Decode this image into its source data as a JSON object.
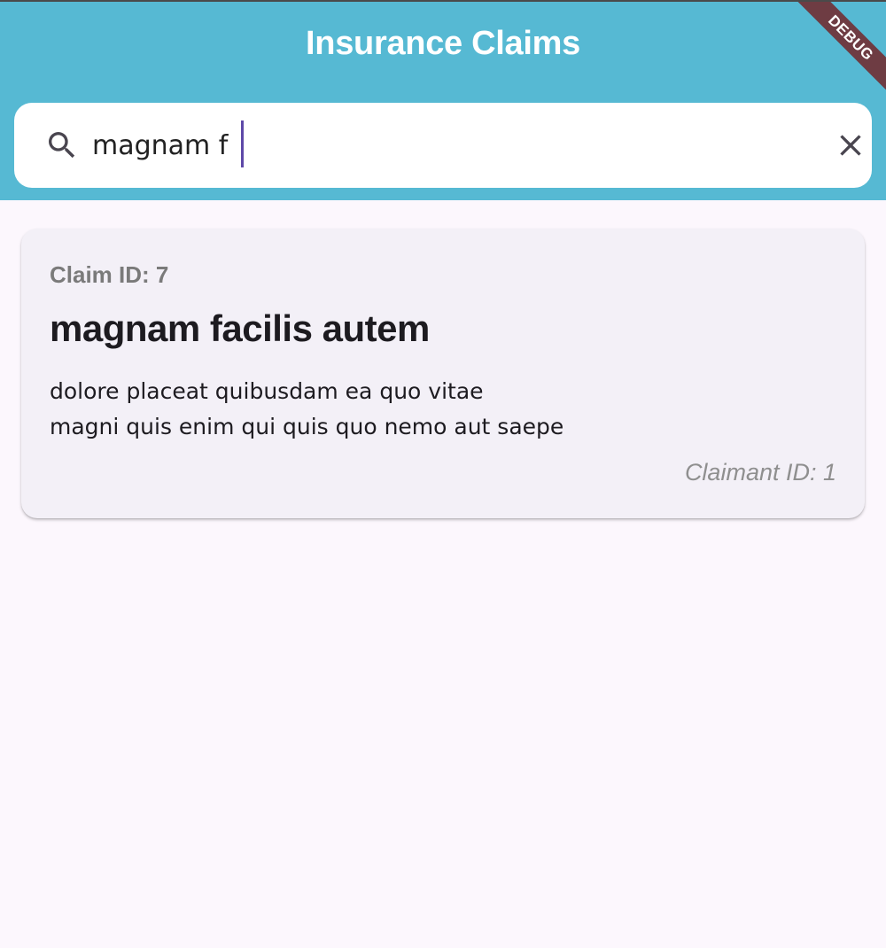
{
  "app_bar": {
    "title": "Insurance Claims",
    "background_color": "#56B9D3",
    "debug_banner": "DEBUG"
  },
  "search": {
    "icon": "search-icon",
    "value": "magnam f",
    "clear_icon": "close-icon"
  },
  "claims": [
    {
      "claim_id_label": "Claim ID: 7",
      "title": "magnam facilis autem",
      "body_lines": [
        "dolore placeat quibusdam ea quo vitae",
        "magni quis enim qui quis quo nemo aut saepe"
      ],
      "claimant_label": "Claimant ID: 1"
    }
  ],
  "colors": {
    "page_background": "#FCF7FD",
    "card_background": "#F3F0F7",
    "caret": "#5E49A8",
    "debug_ribbon": "#6E3C43"
  }
}
